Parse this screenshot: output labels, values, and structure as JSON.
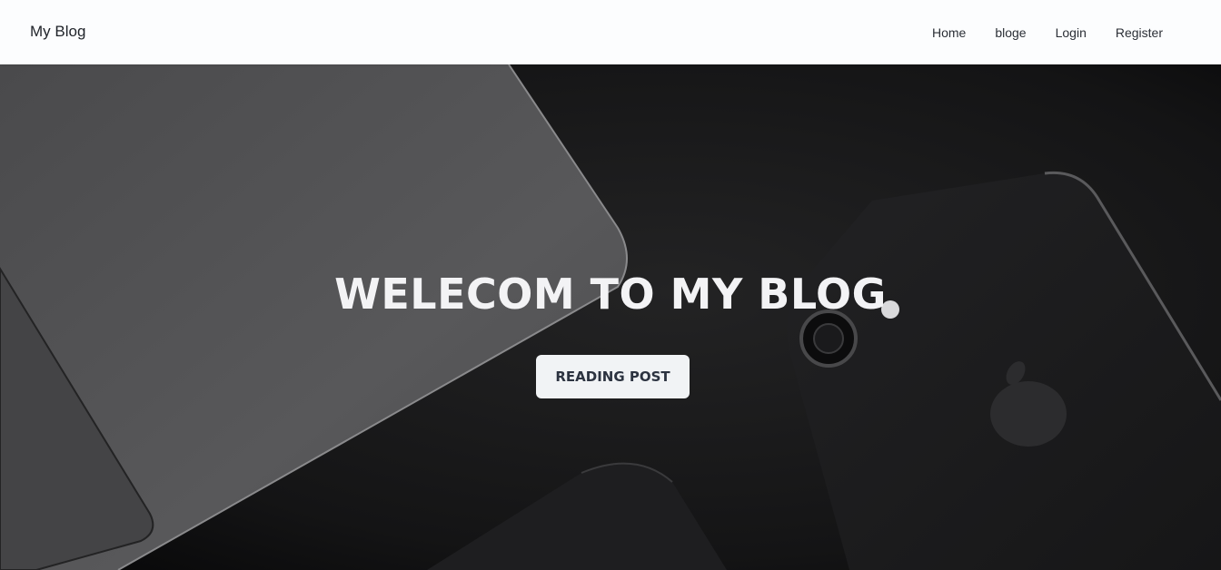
{
  "navbar": {
    "brand": "My Blog",
    "links": [
      {
        "label": "Home"
      },
      {
        "label": "bloge"
      },
      {
        "label": "Login"
      },
      {
        "label": "Register"
      }
    ]
  },
  "hero": {
    "title": "WELECOM TO MY BLOG",
    "button_label": "READING POST"
  },
  "colors": {
    "navbar_bg": "#fcfdfe",
    "hero_dark": "#111112",
    "title_text": "#f3f3f5",
    "button_bg": "#f1f3f5",
    "button_text": "#2c3340"
  }
}
